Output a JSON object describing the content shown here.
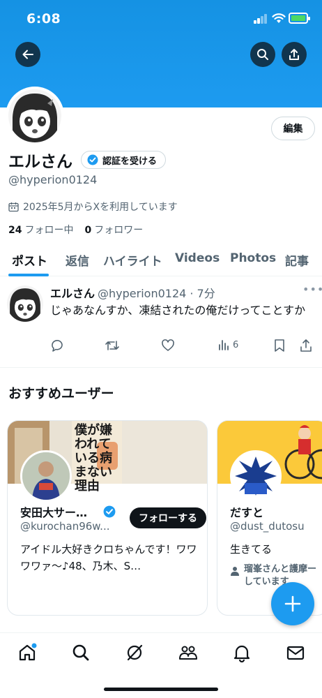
{
  "status_bar": {
    "time": "6:08"
  },
  "profile": {
    "name": "エルさん",
    "verify_label": "認証を受ける",
    "handle": "@hyperion0124",
    "joined": "2025年5月からXを利用しています",
    "following_count": "24",
    "following_label": "フォロー中",
    "followers_count": "0",
    "followers_label": "フォロワー",
    "edit_label": "編集"
  },
  "tabs": [
    {
      "label": "ポスト",
      "active": true
    },
    {
      "label": "返信"
    },
    {
      "label": "ハイライト"
    },
    {
      "label": "Videos"
    },
    {
      "label": "Photos"
    },
    {
      "label": "記事"
    }
  ],
  "post": {
    "name": "エルさん",
    "handle_time": "@hyperion0124 · 7分",
    "text": "じゃあなんすか、凍結されたの俺だけってことすか",
    "views": "6"
  },
  "recommended": {
    "title": "おすすめユーザー",
    "users": [
      {
        "name": "安田大サー…",
        "handle": "@kurochan96w...",
        "bio": "アイドル大好きクロちゃんです！ワワワワァ～♪48、乃木、S…",
        "follow_label": "フォローする",
        "banner_text": "僕が嫌われている病まない理由"
      },
      {
        "name": "だすと",
        "handle": "@dust_dutosu",
        "bio": "生きてる",
        "followed_by": "瑠峯さんと護摩ーしています"
      }
    ]
  },
  "colors": {
    "accent": "#1d9bf0",
    "text": "#0f1419",
    "muted": "#536471"
  }
}
